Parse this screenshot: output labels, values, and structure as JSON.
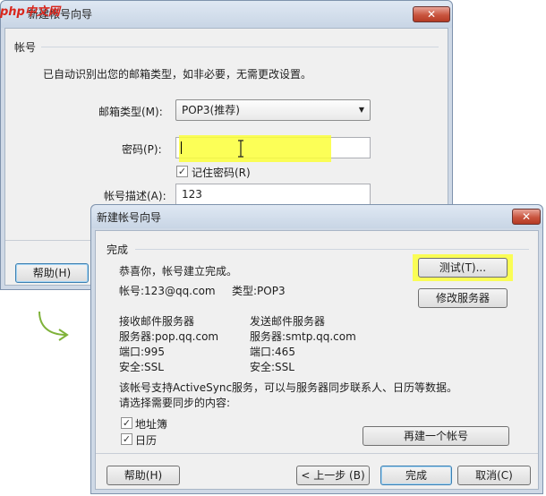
{
  "back_window": {
    "title": "新建帐号向导",
    "close_label": "✕",
    "section_title": "帐号",
    "info_text": "已自动识别出您的邮箱类型，如非必要，无需更改设置。",
    "mail_type_label": "邮箱类型(M):",
    "mail_type_value": "POP3(推荐)",
    "password_label": "密码(P):",
    "password_value": "",
    "remember_label": "记住密码(R)",
    "remember_checked": true,
    "description_label": "帐号描述(A):",
    "description_value": "123",
    "help_label": "帮助(H)"
  },
  "front_window": {
    "title": "新建帐号向导",
    "close_label": "✕",
    "section_title": "完成",
    "congrats_text": "恭喜你，帐号建立完成。",
    "account_text": "帐号:123@qq.com",
    "type_text": "类型:POP3",
    "test_label": "测试(T)...",
    "modify_server_label": "修改服务器",
    "incoming": {
      "heading": "接收邮件服务器",
      "server": "服务器:pop.qq.com",
      "port": "端口:995",
      "security": "安全:SSL"
    },
    "outgoing": {
      "heading": "发送邮件服务器",
      "server": "服务器:smtp.qq.com",
      "port": "端口:465",
      "security": "安全:SSL"
    },
    "activesync_text": "该帐号支持ActiveSync服务，可以与服务器同步联系人、日历等数据。",
    "sync_prompt": "请选择需要同步的内容:",
    "sync_items": [
      {
        "label": "地址簿",
        "checked": true
      },
      {
        "label": "日历",
        "checked": true
      }
    ],
    "create_another_label": "再建一个帐号",
    "help_label": "帮助(H)",
    "back_label": "< 上一步 (B)",
    "finish_label": "完成",
    "cancel_label": "取消(C)"
  },
  "colors": {
    "highlight": "#fbff3a",
    "arrow": "#7fb23a",
    "watermark_red": "#d9261c"
  },
  "icons": {
    "checkmark": "✓",
    "dropdown": "▼",
    "cursor": "I-beam",
    "arrow": "curved-arrow"
  },
  "watermark": "php中文网"
}
